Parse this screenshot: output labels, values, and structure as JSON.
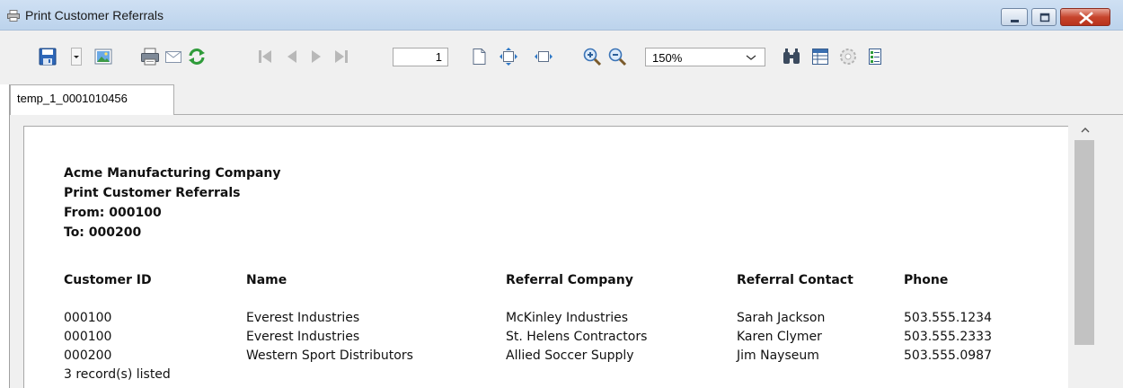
{
  "window": {
    "title": "Print Customer Referrals"
  },
  "toolbar": {
    "page_number": "1",
    "zoom": "150%",
    "icons": [
      "save-icon",
      "save-dropdown-icon",
      "export-image-icon",
      "print-icon",
      "email-icon",
      "refresh-icon",
      "first-page-icon",
      "previous-page-icon",
      "next-page-icon",
      "last-page-icon",
      "single-page-icon",
      "fit-page-icon",
      "fit-width-icon",
      "zoom-in-icon",
      "zoom-out-icon",
      "find-icon",
      "group-tree-icon",
      "parameters-icon",
      "export-icon"
    ]
  },
  "tabs": [
    {
      "label": "temp_1_0001010456"
    }
  ],
  "report": {
    "company": "Acme Manufacturing Company",
    "title": "Print Customer Referrals",
    "from": "From: 000100",
    "to": "To: 000200",
    "columns": [
      "Customer ID",
      "Name",
      "Referral Company",
      "Referral Contact",
      "Phone"
    ],
    "rows": [
      [
        "000100",
        "Everest Industries",
        "McKinley Industries",
        "Sarah Jackson",
        "503.555.1234"
      ],
      [
        "000100",
        "Everest Industries",
        "St. Helens Contractors",
        "Karen Clymer",
        "503.555.2333"
      ],
      [
        "000200",
        "Western Sport Distributors",
        "Allied Soccer Supply",
        "Jim Nayseum",
        "503.555.0987"
      ]
    ],
    "footer": "3 record(s) listed"
  }
}
